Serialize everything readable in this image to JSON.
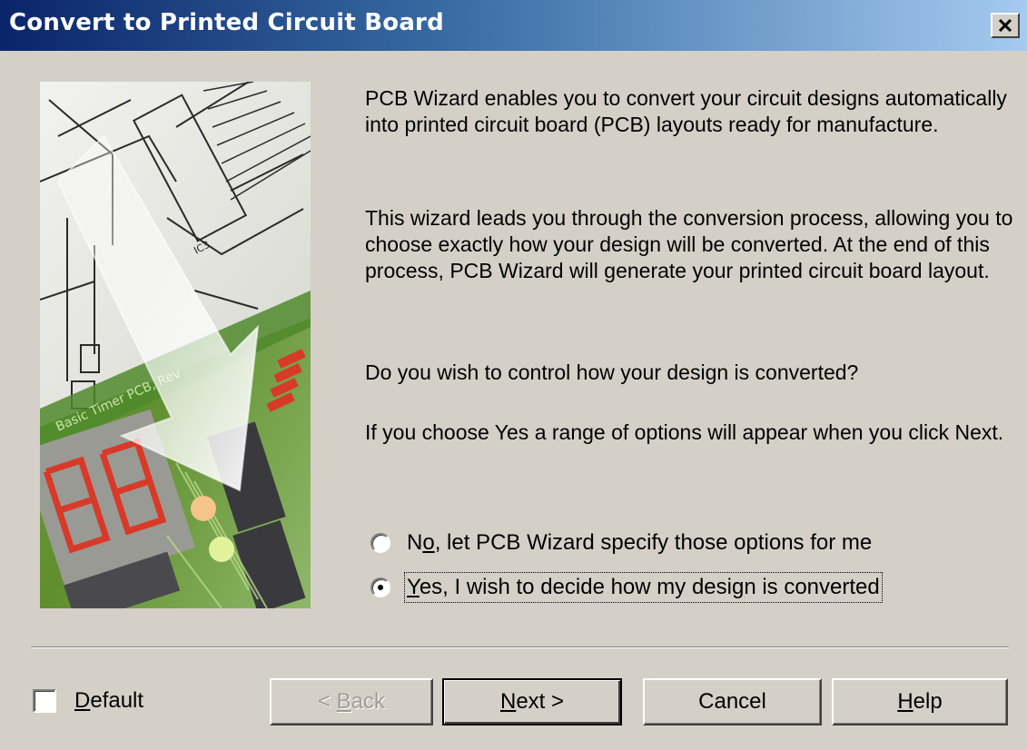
{
  "window": {
    "title": "Convert to Printed Circuit Board",
    "close_symbol": "×"
  },
  "intro": {
    "paragraph1": "PCB Wizard enables you to convert your circuit designs automatically into printed circuit board (PCB) layouts ready for manufacture.",
    "paragraph2": "This wizard leads you through the conversion process, allowing you to choose exactly how your design will be converted. At the end of this process, PCB Wizard will generate your printed circuit board layout.",
    "paragraph3": "Do you wish to control how your design is converted?",
    "paragraph4": "If you choose Yes a range of options will appear when you click Next."
  },
  "options": {
    "no": {
      "prefix": "N",
      "mnemonic": "o",
      "rest": ", let PCB Wizard specify those options for me",
      "selected": false
    },
    "yes": {
      "prefix": "",
      "mnemonic": "Y",
      "rest": "es, I wish to decide how my design is converted",
      "selected": true
    }
  },
  "footer": {
    "default_checkbox": {
      "mnemonic": "D",
      "rest": "efault",
      "checked": false
    },
    "back": {
      "prefix": "< ",
      "mnemonic": "B",
      "rest": "ack",
      "enabled": false
    },
    "next": {
      "mnemonic": "N",
      "rest": "ext >"
    },
    "cancel": {
      "label": "Cancel"
    },
    "help": {
      "mnemonic": "H",
      "rest": "elp"
    }
  },
  "image_text": {
    "chip_label": "IC3",
    "board_text": "Basic Timer PCB, Rev",
    "segment_digits": "88"
  },
  "colors": {
    "title_start": "#0a246a",
    "title_end": "#a6caf0",
    "dialog_face": "#d4d0c8",
    "pcb_green": "#6f9a3a",
    "led_red": "#d83a2a"
  }
}
